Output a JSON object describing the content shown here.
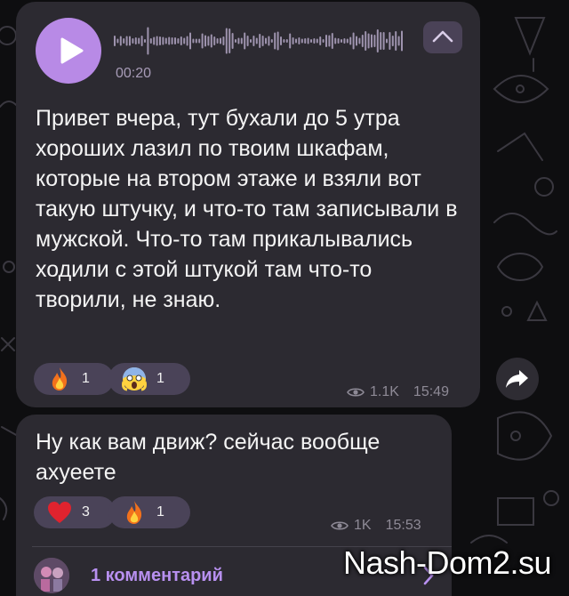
{
  "message1": {
    "voice_duration": "00:20",
    "text": "Привет вчера, тут бухали до 5 утра хороших лазил по твоим шкафам, которые на втором этаже и взяли вот такую штучку, и что-то там записывали в мужской. Что-то там прикалывались ходили с этой штукой там что-то творили, не знаю.",
    "reactions": [
      {
        "emoji": "fire-icon",
        "count": "1"
      },
      {
        "emoji": "scream-face-icon",
        "count": "1"
      }
    ],
    "views": "1.1K",
    "time": "15:49"
  },
  "message2": {
    "text": "Ну как вам движ? сейчас вообще ахуеете",
    "reactions": [
      {
        "emoji": "heart-icon",
        "count": "3"
      },
      {
        "emoji": "fire-icon",
        "count": "1"
      }
    ],
    "views": "1K",
    "time": "15:53",
    "comments_label": "1 комментарий"
  },
  "watermark": "Nash-Dom2.su",
  "colors": {
    "bubble": "#2c2a31",
    "accent": "#b88ae6",
    "background": "#0e0e10",
    "meta": "#8e8a96"
  }
}
